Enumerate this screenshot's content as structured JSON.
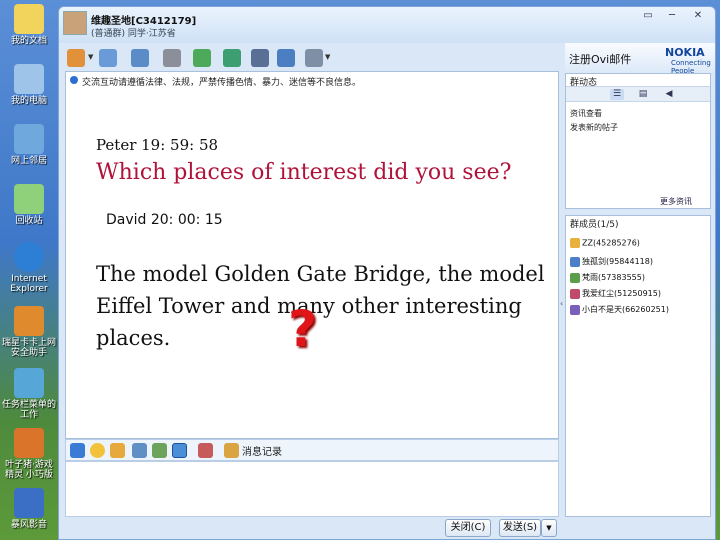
{
  "desktop": {
    "icons": [
      {
        "label": "我的文档",
        "icon": "my-documents-icon",
        "color": "#f2d35c"
      },
      {
        "label": "我的电脑",
        "icon": "my-computer-icon",
        "color": "#9fc4ea"
      },
      {
        "label": "网上邻居",
        "icon": "network-places-icon",
        "color": "#6fa8dc"
      },
      {
        "label": "回收站",
        "icon": "recycle-bin-icon",
        "color": "#8fd17a"
      },
      {
        "label": "Internet Explorer",
        "icon": "internet-explorer-icon",
        "color": "#2d7fd6"
      },
      {
        "label": "瑞星卡卡上网安全助手",
        "icon": "rising-assistant-icon",
        "color": "#e08a2e"
      },
      {
        "label": "任务栏菜单的工作",
        "icon": "taskbar-tool-icon",
        "color": "#56a6d8"
      },
      {
        "label": "叶子猪·游戏精灵 小巧版",
        "icon": "game-helper-icon",
        "color": "#d9742a"
      },
      {
        "label": "暴风影音",
        "icon": "media-player-icon",
        "color": "#3b6fc6"
      }
    ]
  },
  "window": {
    "title_name": "维趣圣地[C3412179]",
    "title_sub": "(普通群) 同学·江苏省",
    "controls": [
      "▭",
      "─",
      "✕"
    ],
    "toolbar_icons": [
      "home-icon",
      "contacts-icon",
      "chat-icon",
      "list-icon",
      "mail-icon",
      "add-icon",
      "tools-icon",
      "share-icon",
      "settings-icon"
    ],
    "notice": "交流互动请遵循法律、法规，严禁传播色情、暴力、迷信等不良信息。",
    "messages": [
      {
        "header": "Peter 19: 59: 58",
        "body": "Which places of interest did you see?"
      },
      {
        "header": "David 20: 00: 15",
        "body": "The model Golden Gate Bridge, the model Eiffel Tower and many other interesting places."
      }
    ],
    "overlay_symbol": "?",
    "input_toolbar": {
      "icons": [
        "font-icon",
        "emoji-icon",
        "wink-icon",
        "image-icon",
        "screenshot-icon",
        "screenshot-options-icon",
        "voice-icon"
      ],
      "history_label": "消息记录"
    },
    "buttons": {
      "close": "关闭(C)",
      "send": "发送(S)",
      "send_options": "▼"
    }
  },
  "ovi": {
    "label": "注册Ovi邮件",
    "brand": "NOKIA",
    "brand_sub": "Connecting People"
  },
  "side_panel": {
    "title": "群动态",
    "tabs": [
      "☰",
      "▤",
      "◀"
    ],
    "lines": [
      "资讯查看",
      "发表新的帖子"
    ],
    "more": "更多资讯"
  },
  "members": {
    "title": "群成员(1/5)",
    "items": [
      "ZZ(45285276)",
      "独孤剑(95844118)",
      "梵雨(57383555)",
      "我爱红尘(51250915)",
      "小白不是天(66260251)"
    ],
    "colors": [
      "#e8b03c",
      "#4d7fc9",
      "#5a9e4a",
      "#c04a6a",
      "#7a5fb8"
    ]
  },
  "accent": "#b0133a"
}
